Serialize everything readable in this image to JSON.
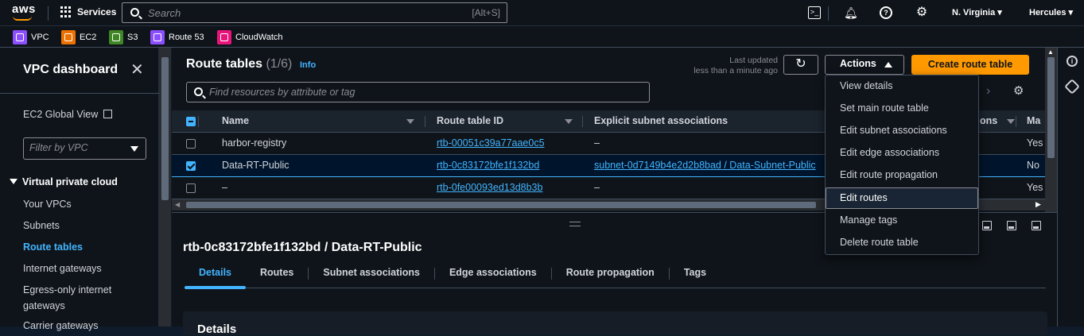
{
  "topbar": {
    "logo": "aws",
    "services_label": "Services",
    "search_placeholder": "Search",
    "search_shortcut": "[Alt+S]",
    "region": "N. Virginia ▾",
    "user": "Hercules ▾"
  },
  "favorites": [
    {
      "label": "VPC",
      "color": "#8c4fff"
    },
    {
      "label": "EC2",
      "color": "#ed7100"
    },
    {
      "label": "S3",
      "color": "#3f8624"
    },
    {
      "label": "Route 53",
      "color": "#8c4fff"
    },
    {
      "label": "CloudWatch",
      "color": "#e7157b"
    }
  ],
  "sidebar": {
    "title": "VPC dashboard",
    "close": "✕",
    "ec2_global": "EC2 Global View",
    "filter_placeholder": "Filter by VPC",
    "section": "Virtual private cloud",
    "items": [
      "Your VPCs",
      "Subnets",
      "Route tables",
      "Internet gateways",
      "Egress-only internet",
      "gateways",
      "Carrier gateways"
    ]
  },
  "main": {
    "title": "Route tables",
    "count": "(1/6)",
    "info": "Info",
    "last_updated_line1": "Last updated",
    "last_updated_line2": "less than a minute ago",
    "actions_label": "Actions",
    "create_label": "Create route table",
    "find_placeholder": "Find resources by attribute or tag",
    "columns": [
      "Name",
      "Route table ID",
      "Explicit subnet associations",
      "ons",
      "Ma"
    ],
    "rows": [
      {
        "name": "harbor-registry",
        "id": "rtb-00051c39a77aae0c5",
        "explicit": "–",
        "main": "Yes",
        "selected": false
      },
      {
        "name": "Data-RT-Public",
        "id": "rtb-0c83172bfe1f132bd",
        "explicit": "subnet-0d7149b4e2d2b8bad / Data-Subnet-Public",
        "main": "No",
        "selected": true
      },
      {
        "name": "–",
        "id": "rtb-0fe00093ed13d8b3b",
        "explicit": "–",
        "main": "Yes",
        "selected": false
      }
    ]
  },
  "detail": {
    "title": "rtb-0c83172bfe1f132bd / Data-RT-Public",
    "tabs": [
      "Details",
      "Routes",
      "Subnet associations",
      "Edge associations",
      "Route propagation",
      "Tags"
    ],
    "panel_title": "Details"
  },
  "actions_menu": [
    "View details",
    "Set main route table",
    "Edit subnet associations",
    "Edit edge associations",
    "Edit route propagation",
    "Edit routes",
    "Manage tags",
    "Delete route table"
  ],
  "colors": {
    "accent": "#42b4ff",
    "primary_button": "#ff9900",
    "background": "#0f141a"
  }
}
